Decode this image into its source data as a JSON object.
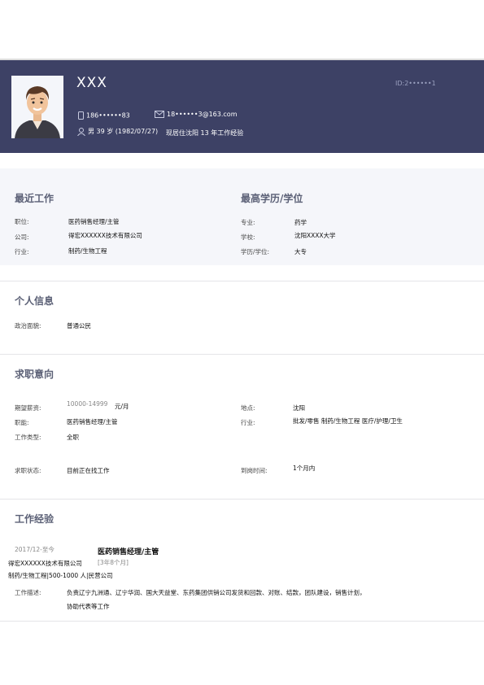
{
  "header": {
    "name": "XXX",
    "id_text": "ID:2••••••1",
    "phone": "186••••••83",
    "email": "18••••••3@163.com",
    "basic": "男 39 岁 (1982/07/27)",
    "residence": "现居住沈阳 13 年工作经验"
  },
  "recent_work": {
    "title": "最近工作",
    "position_label": "职位:",
    "position": "医药销售经理/主管",
    "company_label": "公司:",
    "company": "得宏XXXXXX技术有限公司",
    "industry_label": "行业:",
    "industry": "制药/生物工程"
  },
  "education": {
    "title": "最高学历/学位",
    "major_label": "专业:",
    "major": "药学",
    "school_label": "学校:",
    "school": "沈阳XXXX大学",
    "degree_label": "学历/学位:",
    "degree": "大专"
  },
  "personal": {
    "title": "个人信息",
    "political_label": "政治面貌:",
    "political": "普通公民"
  },
  "intention": {
    "title": "求职意向",
    "salary_label": "期望薪资:",
    "salary": "10000-14999",
    "salary_unit": "元/月",
    "location_label": "地点:",
    "location": "沈阳",
    "job_label": "职能:",
    "job": "医药销售经理/主管",
    "industry_label": "行业:",
    "industry": "批发/零售  制药/生物工程  医疗/护理/卫生",
    "type_label": "工作类型:",
    "type": "全职",
    "status_label": "求职状态:",
    "status": "目前正在找工作",
    "arrival_label": "到岗时间:",
    "arrival": "1个月内"
  },
  "experience": {
    "title": "工作经验",
    "period": "2017/12-至今",
    "position": "医药销售经理/主管",
    "company": "得宏XXXXXX技术有限公司",
    "duration": "[3年8个月]",
    "meta": "制药/生物工程|500-1000 人|民营公司",
    "desc_label": "工作描述:",
    "desc1": "负责辽宁九洲通、辽宁华润、国大天益堂、东药集团供销公司发货和回款、对账、结款，团队建设，销售计划，",
    "desc2": "协助代表等工作"
  }
}
